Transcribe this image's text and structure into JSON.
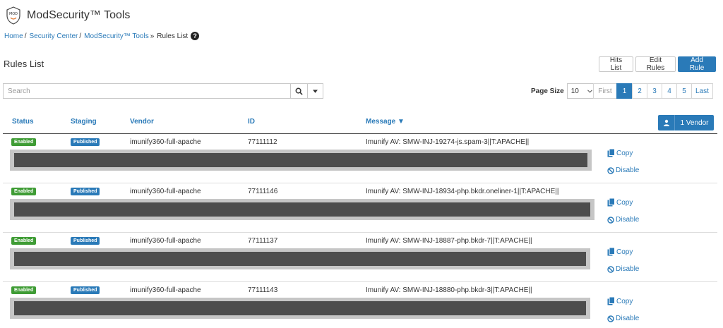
{
  "app": {
    "title": "ModSecurity™ Tools",
    "logo_text": "MOD"
  },
  "breadcrumb": {
    "items": [
      "Home",
      "Security Center",
      "ModSecurity™ Tools"
    ],
    "separators": [
      "/",
      "/",
      "»"
    ],
    "current": "Rules List"
  },
  "page": {
    "title": "Rules List"
  },
  "actions": {
    "hits_list": "Hits List",
    "edit_rules": "Edit Rules",
    "add_rule": "Add Rule"
  },
  "search": {
    "placeholder": "Search",
    "value": ""
  },
  "page_size": {
    "label": "Page Size",
    "value": "10"
  },
  "pagination": {
    "first": "First",
    "pages": [
      "1",
      "2",
      "3",
      "4",
      "5"
    ],
    "active": "1",
    "last": "Last"
  },
  "table": {
    "headers": {
      "status": "Status",
      "staging": "Staging",
      "vendor": "Vendor",
      "id": "ID",
      "message": "Message ▼"
    },
    "vendor_filter": "1 Vendor",
    "rows": [
      {
        "status": "Enabled",
        "staging": "Published",
        "vendor": "imunify360-full-apache",
        "id": "77111112",
        "message": "Imunify AV: SMW-INJ-19274-js.spam-3||T:APACHE||",
        "copy": "Copy",
        "disable": "Disable"
      },
      {
        "status": "Enabled",
        "staging": "Published",
        "vendor": "imunify360-full-apache",
        "id": "77111146",
        "message": "Imunify AV: SMW-INJ-18934-php.bkdr.oneliner-1||T:APACHE||",
        "copy": "Copy",
        "disable": "Disable"
      },
      {
        "status": "Enabled",
        "staging": "Published",
        "vendor": "imunify360-full-apache",
        "id": "77111137",
        "message": "Imunify AV: SMW-INJ-18887-php.bkdr-7||T:APACHE||",
        "copy": "Copy",
        "disable": "Disable"
      },
      {
        "status": "Enabled",
        "staging": "Published",
        "vendor": "imunify360-full-apache",
        "id": "77111143",
        "message": "Imunify AV: SMW-INJ-18880-php.bkdr-3||T:APACHE||",
        "copy": "Copy",
        "disable": "Disable"
      }
    ]
  },
  "colors": {
    "accent": "#2a7ab8",
    "enabled": "#3f9c35",
    "code_bg": "#4d4d4d",
    "code_frame": "#c6c6c6"
  }
}
